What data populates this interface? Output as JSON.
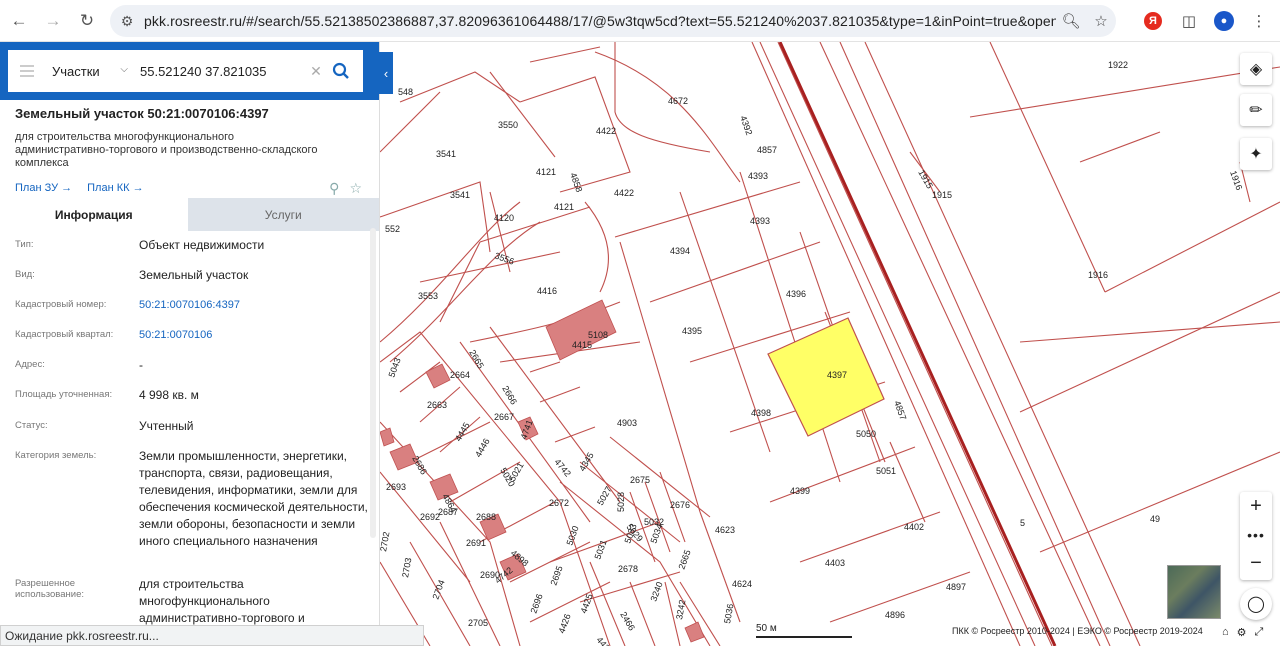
{
  "browser": {
    "url": "pkk.rosreestr.ru/#/search/55.52138502386887,37.82096361064488/17/@5w3tqw5cd?text=55.521240%2037.821035&type=1&inPoint=true&opened=50...",
    "extension_badge": "Я",
    "status_text": "Ожидание pkk.rosreestr.ru..."
  },
  "search": {
    "type_label": "Участки",
    "query": "55.521240 37.821035"
  },
  "parcel": {
    "title": "Земельный участок 50:21:0070106:4397",
    "description": "для строительства многофункционального административно-торгового и производственно-складского комплекса",
    "plan_zu": "План ЗУ →",
    "plan_kk": "План КК →"
  },
  "tabs": [
    {
      "label": "Информация",
      "active": true
    },
    {
      "label": "Услуги",
      "active": false
    }
  ],
  "info": [
    {
      "label": "Тип:",
      "value": "Объект недвижимости",
      "link": false
    },
    {
      "label": "Вид:",
      "value": "Земельный участок",
      "link": false
    },
    {
      "label": "Кадастровый номер:",
      "value": "50:21:0070106:4397",
      "link": true
    },
    {
      "label": "Кадастровый квартал:",
      "value": "50:21:0070106",
      "link": true
    },
    {
      "label": "Адрес:",
      "value": "-",
      "link": false
    },
    {
      "label": "Площадь уточненная:",
      "value": "4 998 кв. м",
      "link": false
    },
    {
      "label": "Статус:",
      "value": "Учтенный",
      "link": false
    },
    {
      "label": "Категория земель:",
      "value": "Земли промышленности, энергетики, транспорта, связи, радиовещания, телевидения, информатики, земли для обеспечения космической деятельности, земли обороны, безопасности и земли иного специального назначения",
      "link": false
    },
    {
      "label": "Разрешенное использование:",
      "value": "для строительства многофункционального административно-торгового и",
      "link": false
    }
  ],
  "map": {
    "parcel_labels": [
      {
        "t": "1922"
      },
      {
        "t": "4672"
      },
      {
        "t": "3550"
      },
      {
        "t": "4422"
      },
      {
        "t": "4392"
      },
      {
        "t": "548"
      },
      {
        "t": "3541"
      },
      {
        "t": "4121"
      },
      {
        "t": "4858"
      },
      {
        "t": "4857"
      },
      {
        "t": "4393"
      },
      {
        "t": "1915"
      },
      {
        "t": "1915"
      },
      {
        "t": "1916"
      },
      {
        "t": "3541"
      },
      {
        "t": "4422"
      },
      {
        "t": "4121"
      },
      {
        "t": "4120"
      },
      {
        "t": "4393"
      },
      {
        "t": "552"
      },
      {
        "t": "3556"
      },
      {
        "t": "4394"
      },
      {
        "t": "1916"
      },
      {
        "t": "4416"
      },
      {
        "t": "4396"
      },
      {
        "t": "3553"
      },
      {
        "t": "5108"
      },
      {
        "t": "4415"
      },
      {
        "t": "4395"
      },
      {
        "t": "2665"
      },
      {
        "t": "4397"
      },
      {
        "t": "2664"
      },
      {
        "t": "5043"
      },
      {
        "t": "2666"
      },
      {
        "t": "4857"
      },
      {
        "t": "2663"
      },
      {
        "t": "4398"
      },
      {
        "t": "2667"
      },
      {
        "t": "4903"
      },
      {
        "t": "5050"
      },
      {
        "t": "4445"
      },
      {
        "t": "4741"
      },
      {
        "t": "2686"
      },
      {
        "t": "4446"
      },
      {
        "t": "5020"
      },
      {
        "t": "4742"
      },
      {
        "t": "4345"
      },
      {
        "t": "5051"
      },
      {
        "t": "2693"
      },
      {
        "t": "5021"
      },
      {
        "t": "2675"
      },
      {
        "t": "4399"
      },
      {
        "t": "4864"
      },
      {
        "t": "2687"
      },
      {
        "t": "2672"
      },
      {
        "t": "2676"
      },
      {
        "t": "5027"
      },
      {
        "t": "5028"
      },
      {
        "t": "2692"
      },
      {
        "t": "2688"
      },
      {
        "t": "5029"
      },
      {
        "t": "5032"
      },
      {
        "t": "4402"
      },
      {
        "t": "49"
      },
      {
        "t": "4623"
      },
      {
        "t": "5"
      },
      {
        "t": "2691"
      },
      {
        "t": "5030"
      },
      {
        "t": "5033"
      },
      {
        "t": "5034"
      },
      {
        "t": "4898"
      },
      {
        "t": "2702"
      },
      {
        "t": "5031"
      },
      {
        "t": "2678"
      },
      {
        "t": "2665"
      },
      {
        "t": "4403"
      },
      {
        "t": "2690"
      },
      {
        "t": "4742"
      },
      {
        "t": "2703"
      },
      {
        "t": "2695"
      },
      {
        "t": "4624"
      },
      {
        "t": "4897"
      },
      {
        "t": "2704"
      },
      {
        "t": "3240"
      },
      {
        "t": "2696"
      },
      {
        "t": "4425"
      },
      {
        "t": "3242"
      },
      {
        "t": "2466"
      },
      {
        "t": "4896"
      },
      {
        "t": "2705"
      },
      {
        "t": "5036"
      },
      {
        "t": "4426"
      },
      {
        "t": "4424"
      }
    ],
    "highlight_color": "#ffff66",
    "boundary_color": "#c0504d",
    "building_color": "#d98080",
    "scale_label": "50 м",
    "copyright": "ПКК © Росреестр 2010-2024 | ЕЭКО © Росреестр 2019-2024"
  },
  "controls": {
    "layers_icon": "layers-icon",
    "ruler_icon": "ruler-icon",
    "locate_icon": "locate-icon",
    "zoom_in": "+",
    "zoom_more": "•••",
    "zoom_out": "−"
  }
}
